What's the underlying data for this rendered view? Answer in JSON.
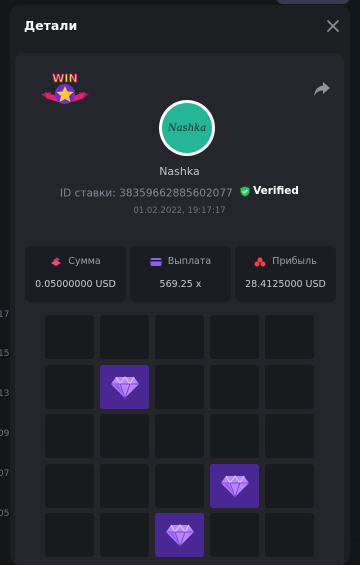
{
  "modal": {
    "title": "Детали",
    "close_icon": "close-icon"
  },
  "bet": {
    "win_badge_text": "WIN",
    "username": "Nashka",
    "avatar_text": "Nashka",
    "bet_id_label": "ID ставки:",
    "bet_id": "38359662885602077",
    "verified_label": "Verified",
    "timestamp": "01.02.2022, 19:17:17"
  },
  "stats": [
    {
      "label": "Сумма",
      "value": "0.05000000 USD",
      "icon": "coins-icon",
      "color": "#f2487a"
    },
    {
      "label": "Выплата",
      "value": "569.25 x",
      "icon": "wallet-icon",
      "color": "#8b5cf6"
    },
    {
      "label": "Прибыль",
      "value": "28.4125000 USD",
      "icon": "profit-icon",
      "color": "#ef4444"
    }
  ],
  "grid": {
    "rows_visible": 5,
    "cols": 5,
    "gem_cells": [
      [
        1,
        1
      ],
      [
        3,
        3
      ],
      [
        4,
        2
      ]
    ]
  },
  "background": {
    "side_numbers": [
      "17",
      "15",
      "13",
      "09",
      "07",
      "05"
    ],
    "bottom_text": "0.05"
  },
  "colors": {
    "accent_purple": "#4a2893",
    "verified_green": "#22c55e"
  }
}
